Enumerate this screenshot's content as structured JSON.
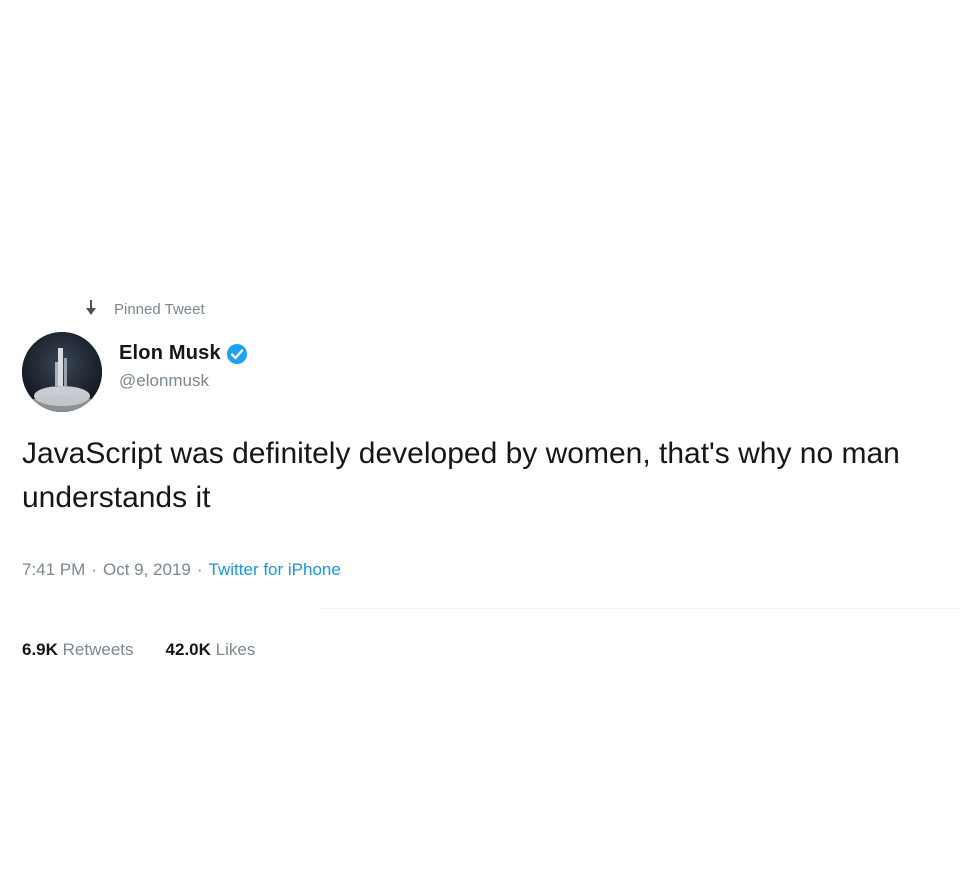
{
  "pinned": {
    "label": "Pinned Tweet",
    "icon": "pin-icon"
  },
  "author": {
    "name": "Elon Musk",
    "handle": "@elonmusk",
    "verified": true,
    "verified_color": "#1da1f2",
    "avatar": "avatar-rocket-launch-image"
  },
  "tweet": {
    "text": "JavaScript was definitely developed by women, that's why no man understands it"
  },
  "meta": {
    "time": "7:41 PM",
    "separator": "·",
    "date": "Oct 9, 2019",
    "source": "Twitter for iPhone"
  },
  "stats": [
    {
      "count": "6.9K",
      "label": "Retweets"
    },
    {
      "count": "42.0K",
      "label": "Likes"
    }
  ],
  "colors": {
    "text": "#14171a",
    "secondary": "#7b8790",
    "link": "#1b95e0"
  }
}
